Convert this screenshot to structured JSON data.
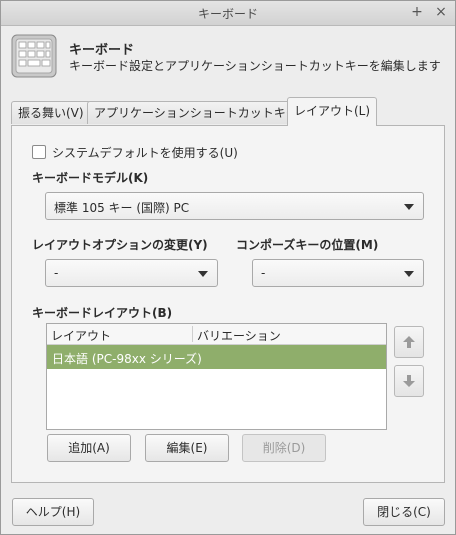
{
  "window": {
    "title": "キーボード",
    "maximize_label": "+",
    "close_label": "×"
  },
  "header": {
    "icon": "keyboard-icon",
    "title": "キーボード",
    "description": "キーボード設定とアプリケーションショートカットキーを編集します"
  },
  "tabs": [
    {
      "label": "振る舞い(V)",
      "active": false
    },
    {
      "label": "アプリケーションショートカットキー(P)",
      "active": false
    },
    {
      "label": "レイアウト(L)",
      "active": true
    }
  ],
  "layout": {
    "use_system_default": {
      "label": "システムデフォルトを使用する(U)",
      "checked": false
    },
    "keyboard_model": {
      "label": "キーボードモデル(K)",
      "value": "標準 105 キー (国際) PC"
    },
    "layout_options": {
      "label": "レイアウトオプションの変更(Y)",
      "value": "-"
    },
    "compose_key": {
      "label": "コンポーズキーの位置(M)",
      "value": "-"
    },
    "keyboard_layout": {
      "label": "キーボードレイアウト(B)",
      "columns": [
        "レイアウト",
        "バリエーション"
      ],
      "rows": [
        {
          "layout": "日本語 (PC-98xx シリーズ)",
          "variation": "",
          "selected": true
        }
      ],
      "move_up_icon": "arrow-up-icon",
      "move_down_icon": "arrow-down-icon"
    },
    "buttons": {
      "add": "追加(A)",
      "edit": "編集(E)",
      "remove": "削除(D)"
    }
  },
  "footer": {
    "help": "ヘルプ(H)",
    "close": "閉じる(C)"
  },
  "colors": {
    "selection": "#8fae6b",
    "background": "#ededed"
  }
}
